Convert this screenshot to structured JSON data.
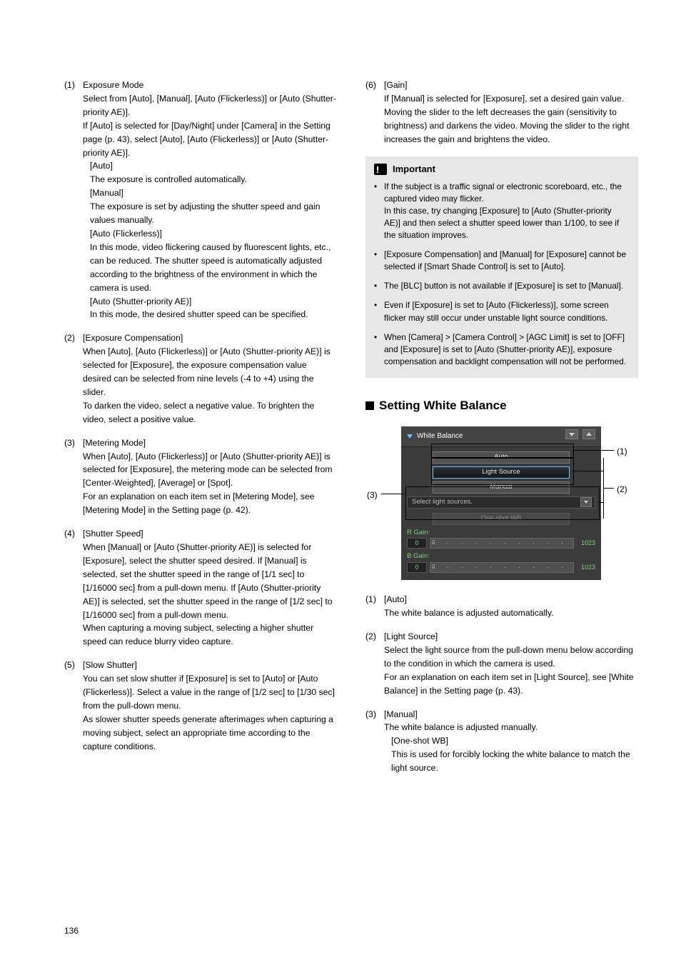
{
  "page_number": "136",
  "left": {
    "items": [
      {
        "num": "(1)",
        "title": "Exposure Mode",
        "body": "Select from [Auto], [Manual], [Auto (Flickerless)] or [Auto (Shutter-priority AE)].\nIf [Auto] is selected for [Day/Night] under [Camera] in the Setting page (p. 43), select [Auto], [Auto (Flickerless)] or [Auto (Shutter-priority AE)].",
        "subs": [
          {
            "h": "[Auto]",
            "t": "The exposure is controlled automatically."
          },
          {
            "h": "[Manual]",
            "t": "The exposure is set by adjusting the shutter speed and gain values manually."
          },
          {
            "h": "[Auto (Flickerless)]",
            "t": "In this mode, video flickering caused by fluorescent lights, etc., can be reduced. The shutter speed is automatically adjusted according to the brightness of the environment in which the camera is used."
          },
          {
            "h": "[Auto (Shutter-priority AE)]",
            "t": "In this mode, the desired shutter speed can be specified."
          }
        ]
      },
      {
        "num": "(2)",
        "title": "[Exposure Compensation]",
        "body": "When [Auto], [Auto (Flickerless)] or [Auto (Shutter-priority AE)] is selected for [Exposure], the exposure compensation value desired can be selected from nine levels (-4 to +4) using the slider.\nTo darken the video, select a negative value. To brighten the video, select a positive value."
      },
      {
        "num": "(3)",
        "title": "[Metering Mode]",
        "body": "When [Auto], [Auto (Flickerless)] or [Auto (Shutter-priority AE)] is selected for [Exposure], the metering mode can be selected from [Center-Weighted], [Average] or [Spot].\nFor an explanation on each item set in [Metering Mode], see [Metering Mode] in the Setting page (p. 42)."
      },
      {
        "num": "(4)",
        "title": "[Shutter Speed]",
        "body": "When [Manual] or [Auto (Shutter-priority AE)] is selected for [Exposure], select the shutter speed desired. If [Manual] is selected, set the shutter speed in the range of [1/1 sec] to [1/16000 sec] from a pull-down menu. If [Auto (Shutter-priority AE)] is selected, set the shutter speed in the range of [1/2 sec] to [1/16000 sec] from a pull-down menu.\nWhen capturing a moving subject, selecting a higher shutter speed can reduce blurry video capture."
      },
      {
        "num": "(5)",
        "title": "[Slow Shutter]",
        "body": "You can set slow shutter if [Exposure] is set to [Auto] or [Auto (Flickerless)]. Select a value in the range of [1/2 sec] to [1/30 sec] from the pull-down menu.\nAs slower shutter speeds generate afterimages when capturing a moving subject, select an appropriate time according to the capture conditions."
      }
    ]
  },
  "right_top": {
    "num": "(6)",
    "title": "[Gain]",
    "body": "If [Manual] is selected for [Exposure], set a desired gain value.\nMoving the slider to the left decreases the gain (sensitivity to brightness) and darkens the video. Moving the slider to the right increases the gain and brightens the video."
  },
  "important": {
    "title": "Important",
    "bullets": [
      "If the subject is a traffic signal or electronic scoreboard, etc., the captured video may flicker.\nIn this case, try changing [Exposure] to [Auto (Shutter-priority AE)] and then select a shutter speed lower than 1/100, to see if the situation improves.",
      "[Exposure Compensation] and [Manual] for [Exposure] cannot be selected if [Smart Shade Control] is set to [Auto].",
      "The [BLC] button is not available if [Exposure] is set to [Manual].",
      "Even if  [Exposure] is set to [Auto (Flickerless)], some screen flicker may still occur under unstable light source conditions.",
      "When [Camera] > [Camera Control] > [AGC Limit] is set to [OFF] and [Exposure] is set to [Auto (Shutter-priority AE)], exposure compensation and backlight compensation will not be performed."
    ]
  },
  "wb": {
    "heading": "Setting White Balance",
    "panel_title": "White Balance",
    "btn_auto": "Auto",
    "btn_light": "Light Source",
    "btn_manual": "Manual",
    "select_ph": "Select light sources.",
    "oneshot": "One-shot WB",
    "rgain": "R Gain:",
    "bgain": "B Gain:",
    "gain_val": "0",
    "gain_min": "0",
    "gain_max": "1023",
    "call1": "(1)",
    "call2": "(2)",
    "call3": "(3)",
    "items": [
      {
        "num": "(1)",
        "title": "[Auto]",
        "body": "The white balance is adjusted automatically."
      },
      {
        "num": "(2)",
        "title": "[Light Source]",
        "body": "Select the light source from the pull-down menu below according to the condition in which the camera is used.\nFor an explanation on each item set in [Light Source], see [White Balance] in the Setting page (p. 43)."
      },
      {
        "num": "(3)",
        "title": "[Manual]",
        "body": "The white balance is adjusted manually.",
        "sub_h": "[One-shot WB]",
        "sub_t": "This is used for forcibly locking the white balance to match the light source."
      }
    ]
  }
}
